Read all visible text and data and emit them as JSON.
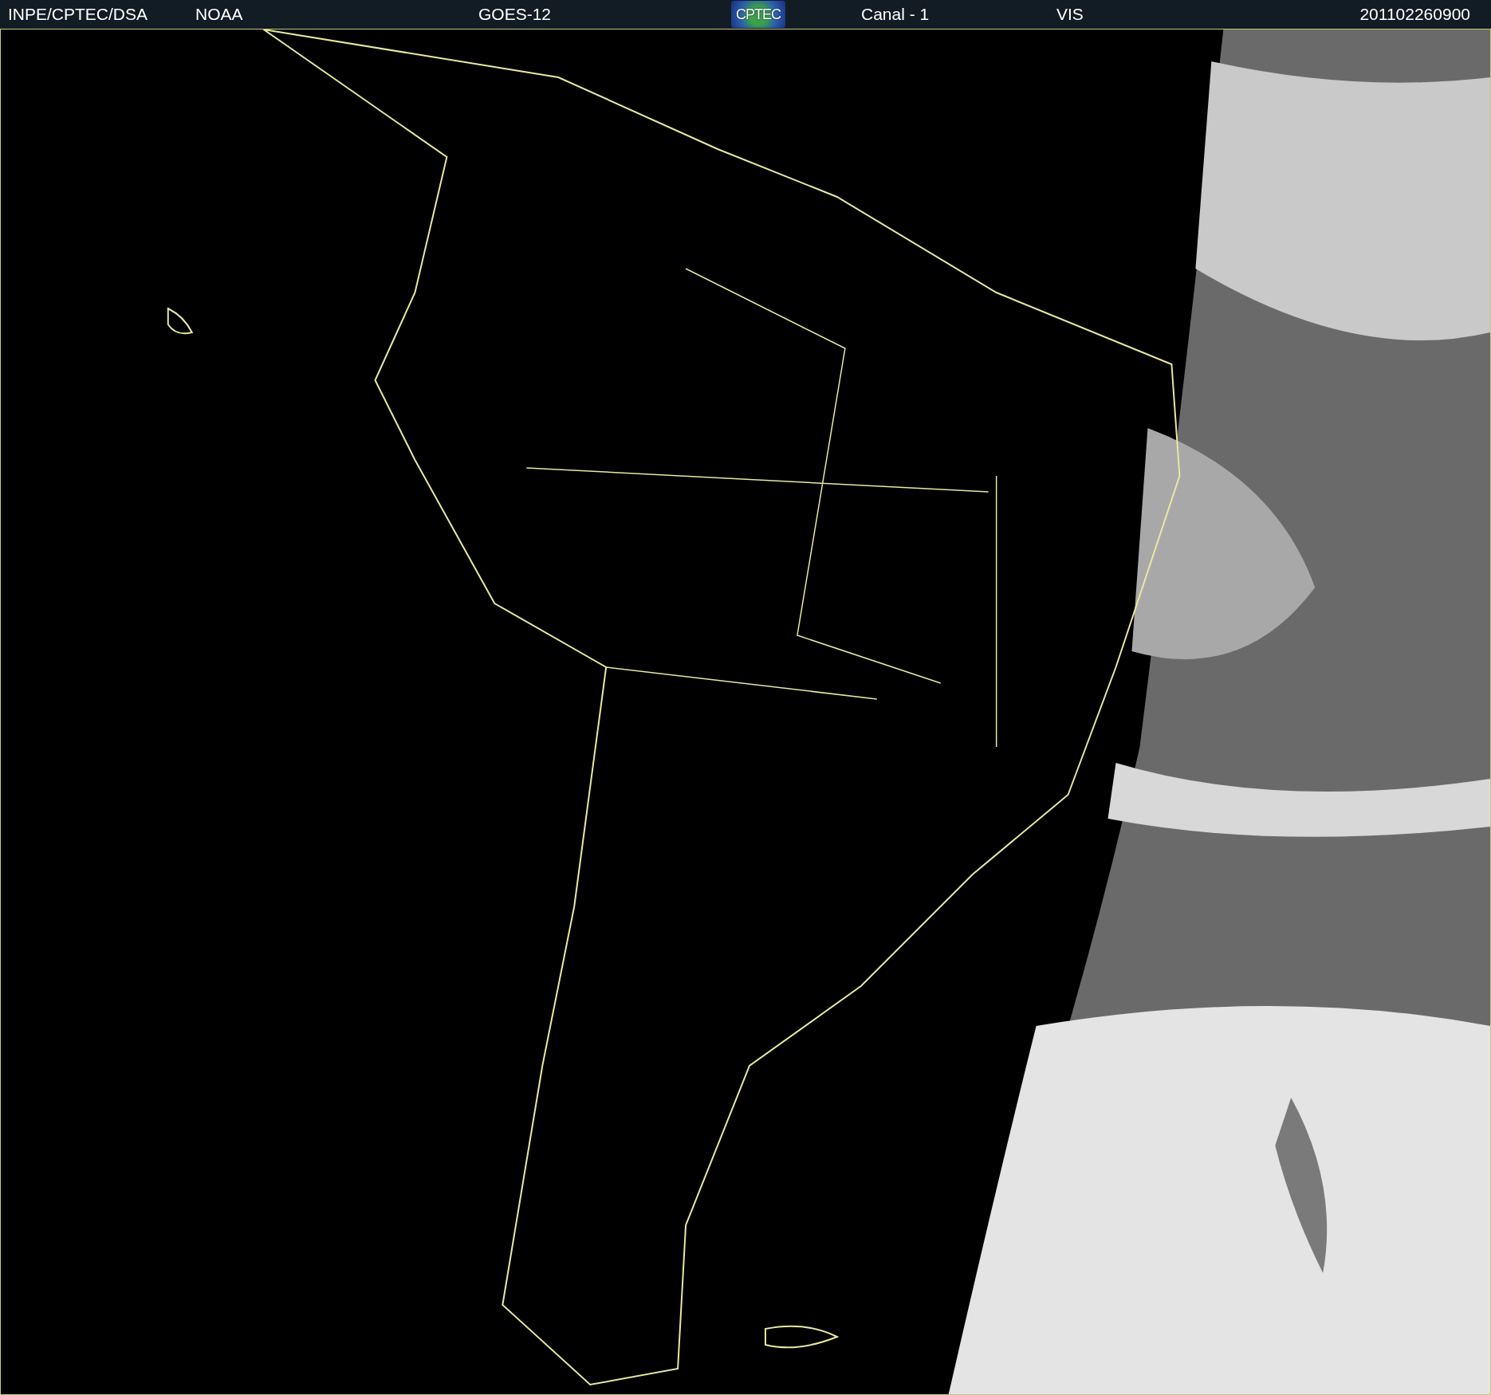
{
  "header": {
    "items": [
      {
        "kind": "text",
        "label": "INPE/CPTEC/DSA"
      },
      {
        "kind": "text",
        "label": "NOAA"
      },
      {
        "kind": "text",
        "label": "GOES-12"
      },
      {
        "kind": "logo",
        "label": "CPTEC"
      },
      {
        "kind": "text",
        "label": "Canal - 1"
      },
      {
        "kind": "text",
        "label": "VIS"
      },
      {
        "kind": "text",
        "label": "201102260900"
      }
    ]
  }
}
